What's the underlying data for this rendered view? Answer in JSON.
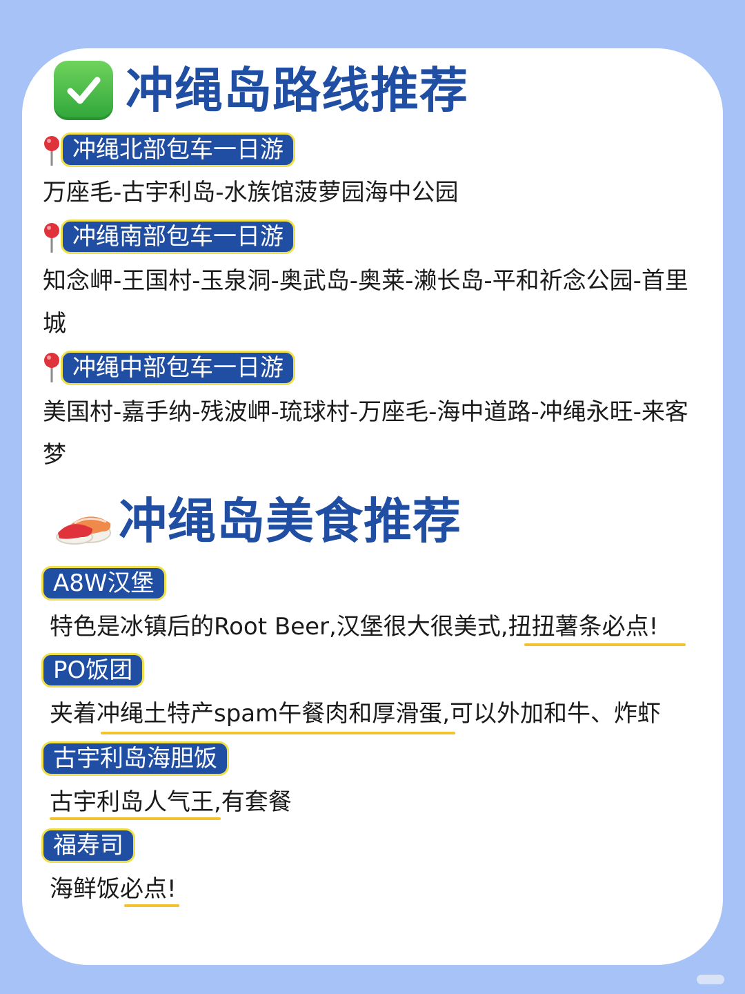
{
  "routes": {
    "title": "冲绳岛路线推荐",
    "items": [
      {
        "label": "冲绳北部包车一日游",
        "desc": "万座毛-古宇利岛-水族馆菠萝园海中公园"
      },
      {
        "label": "冲绳南部包车一日游",
        "desc": "知念岬-王国村-玉泉洞-奥武岛-奥莱-濑长岛-平和祈念公园-首里城"
      },
      {
        "label": "冲绳中部包车一日游",
        "desc": "美国村-嘉手纳-残波岬-琉球村-万座毛-海中道路-冲绳永旺-来客梦"
      }
    ]
  },
  "food": {
    "title": "冲绳岛美食推荐",
    "items": [
      {
        "label": "A8W汉堡",
        "desc": "特色是冰镇后的Root Beer,汉堡很大很美式,扭扭薯条必点!"
      },
      {
        "label": "PO饭团",
        "desc": "夹着冲绳土特产spam午餐肉和厚滑蛋,可以外加和牛、炸虾"
      },
      {
        "label": "古宇利岛海胆饭",
        "desc": "古宇利岛人气王,有套餐"
      },
      {
        "label": "福寿司",
        "desc": "海鲜饭必点!"
      }
    ]
  },
  "colors": {
    "background": "#a7c2f6",
    "title": "#1f4ea3",
    "pill_fill": "#1f4ea3",
    "pill_border": "#f0df4a",
    "underline": "#f2c230"
  },
  "icons": {
    "routes_title": "check-mark-button-icon",
    "food_title": "sushi-icon",
    "route_item": "round-pushpin-icon"
  }
}
